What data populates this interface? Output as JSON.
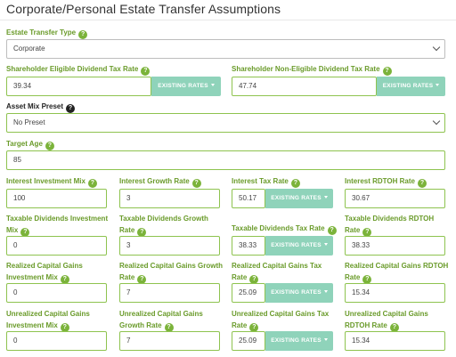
{
  "title": "Corporate/Personal Estate Transfer Assumptions",
  "existing_rates_label": "EXISTING RATES",
  "estate_transfer_type": {
    "label": "Estate Transfer Type",
    "value": "Corporate"
  },
  "shareholder_eligible": {
    "label": "Shareholder Eligible Dividend Tax Rate",
    "value": "39.34"
  },
  "shareholder_non_eligible": {
    "label": "Shareholder Non-Eligible Dividend Tax Rate",
    "value": "47.74"
  },
  "asset_mix_preset": {
    "label": "Asset Mix Preset",
    "value": "No Preset"
  },
  "target_age": {
    "label": "Target Age",
    "value": "85"
  },
  "grid": {
    "interest_investment_mix": {
      "label": "Interest Investment Mix",
      "value": "100"
    },
    "interest_growth_rate": {
      "label": "Interest Growth Rate",
      "value": "3"
    },
    "interest_tax_rate": {
      "label": "Interest Tax Rate",
      "value": "50.17"
    },
    "interest_rdtoh_rate": {
      "label": "Interest RDTOH Rate",
      "value": "30.67"
    },
    "taxable_div_investment_mix": {
      "label_1": "Taxable Dividends Investment",
      "label_2": "Mix",
      "value": "0"
    },
    "taxable_div_growth_rate": {
      "label_1": "Taxable Dividends Growth",
      "label_2": "Rate",
      "value": "3"
    },
    "taxable_div_tax_rate": {
      "label": "Taxable Dividends Tax Rate",
      "value": "38.33"
    },
    "taxable_div_rdtoh_rate": {
      "label_1": "Taxable Dividends RDTOH",
      "label_2": "Rate",
      "value": "38.33"
    },
    "realized_cg_investment_mix": {
      "label_1": "Realized Capital Gains",
      "label_2": "Investment Mix",
      "value": "0"
    },
    "realized_cg_growth_rate": {
      "label_1": "Realized Capital Gains Growth",
      "label_2": "Rate",
      "value": "7"
    },
    "realized_cg_tax_rate": {
      "label_1": "Realized Capital Gains Tax",
      "label_2": "Rate",
      "value": "25.09"
    },
    "realized_cg_rdtoh_rate": {
      "label_1": "Realized Capital Gains RDTOH",
      "label_2": "Rate",
      "value": "15.34"
    },
    "unrealized_cg_investment_mix": {
      "label_1": "Unrealized Capital Gains",
      "label_2": "Investment Mix",
      "value": "0"
    },
    "unrealized_cg_growth_rate": {
      "label_1": "Unrealized Capital Gains",
      "label_2": "Growth Rate",
      "value": "7"
    },
    "unrealized_cg_tax_rate": {
      "label_1": "Unrealized Capital Gains Tax",
      "label_2": "Rate",
      "value": "25.09"
    },
    "unrealized_cg_rdtoh_rate": {
      "label_1": "Unrealized Capital Gains",
      "label_2": "RDTOH Rate",
      "value": "15.34"
    }
  },
  "colors": {
    "accent": "#7bb33a",
    "field_border": "#8ec34f",
    "button": "#8fd3ba"
  },
  "icons": {
    "help": "question-circle-icon",
    "caret": "chevron-down-icon"
  }
}
